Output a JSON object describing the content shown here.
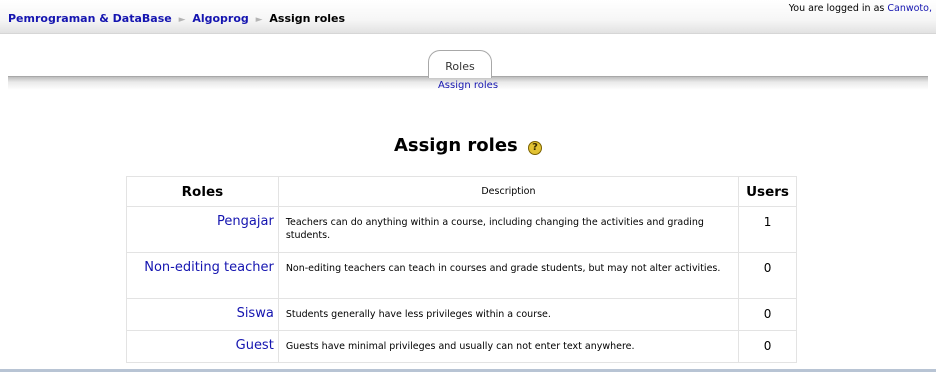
{
  "breadcrumb": {
    "course": "Pemrograman & DataBase",
    "module": "Algoprog",
    "current": "Assign roles",
    "separator": "►"
  },
  "login": {
    "prefix": "You are logged in as ",
    "user": "Canwoto,"
  },
  "tabs": {
    "active": "Roles",
    "sub": "Assign roles"
  },
  "page": {
    "title": "Assign roles",
    "help_glyph": "?"
  },
  "table": {
    "headers": {
      "roles": "Roles",
      "description": "Description",
      "users": "Users"
    },
    "rows": [
      {
        "role": "Pengajar",
        "description": "Teachers can do anything within a course, including changing the activities and grading students.",
        "users": "1"
      },
      {
        "role": "Non-editing teacher",
        "description": "Non-editing teachers can teach in courses and grade students, but may not alter activities.",
        "users": "0"
      },
      {
        "role": "Siswa",
        "description": "Students generally have less privileges within a course.",
        "users": "0"
      },
      {
        "role": "Guest",
        "description": "Guests have minimal privileges and usually can not enter text anywhere.",
        "users": "0"
      }
    ]
  },
  "colors": {
    "link": "#1515b0",
    "footer_line": "#b8c4d4"
  }
}
